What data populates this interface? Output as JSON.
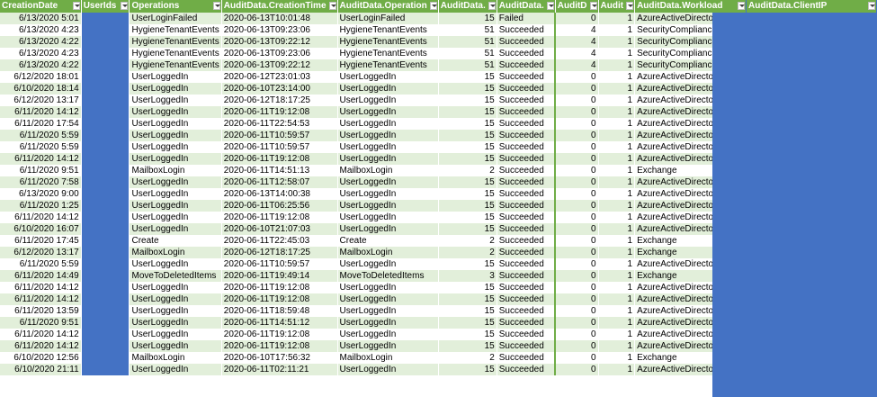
{
  "headers": [
    "CreationDate",
    "UserIds",
    "Operations",
    "AuditData.CreationTime",
    "AuditData.Operation",
    "AuditData.",
    "AuditData.",
    "AuditD",
    "Audit",
    "AuditData.Workload",
    "AuditData.ClientIP"
  ],
  "rows": [
    [
      "6/13/2020 5:01",
      "",
      "UserLoginFailed",
      "2020-06-13T10:01:48",
      "UserLoginFailed",
      "15",
      "Failed",
      "0",
      "1",
      "AzureActiveDirectory",
      ""
    ],
    [
      "6/13/2020 4:23",
      "",
      "HygieneTenantEvents",
      "2020-06-13T09:23:06",
      "HygieneTenantEvents",
      "51",
      "Succeeded",
      "4",
      "1",
      "SecurityComplianceCenter",
      ""
    ],
    [
      "6/13/2020 4:22",
      "",
      "HygieneTenantEvents",
      "2020-06-13T09:22:12",
      "HygieneTenantEvents",
      "51",
      "Succeeded",
      "4",
      "1",
      "SecurityComplianceCenter",
      ""
    ],
    [
      "6/13/2020 4:23",
      "",
      "HygieneTenantEvents",
      "2020-06-13T09:23:06",
      "HygieneTenantEvents",
      "51",
      "Succeeded",
      "4",
      "1",
      "SecurityComplianceCenter",
      ""
    ],
    [
      "6/13/2020 4:22",
      "",
      "HygieneTenantEvents",
      "2020-06-13T09:22:12",
      "HygieneTenantEvents",
      "51",
      "Succeeded",
      "4",
      "1",
      "SecurityComplianceCenter",
      ""
    ],
    [
      "6/12/2020 18:01",
      "",
      "UserLoggedIn",
      "2020-06-12T23:01:03",
      "UserLoggedIn",
      "15",
      "Succeeded",
      "0",
      "1",
      "AzureActiveDirectory",
      ""
    ],
    [
      "6/10/2020 18:14",
      "",
      "UserLoggedIn",
      "2020-06-10T23:14:00",
      "UserLoggedIn",
      "15",
      "Succeeded",
      "0",
      "1",
      "AzureActiveDirectory",
      ""
    ],
    [
      "6/12/2020 13:17",
      "",
      "UserLoggedIn",
      "2020-06-12T18:17:25",
      "UserLoggedIn",
      "15",
      "Succeeded",
      "0",
      "1",
      "AzureActiveDirectory",
      ""
    ],
    [
      "6/11/2020 14:12",
      "",
      "UserLoggedIn",
      "2020-06-11T19:12:08",
      "UserLoggedIn",
      "15",
      "Succeeded",
      "0",
      "1",
      "AzureActiveDirectory",
      ""
    ],
    [
      "6/11/2020 17:54",
      "",
      "UserLoggedIn",
      "2020-06-11T22:54:53",
      "UserLoggedIn",
      "15",
      "Succeeded",
      "0",
      "1",
      "AzureActiveDirectory",
      ""
    ],
    [
      "6/11/2020 5:59",
      "",
      "UserLoggedIn",
      "2020-06-11T10:59:57",
      "UserLoggedIn",
      "15",
      "Succeeded",
      "0",
      "1",
      "AzureActiveDirectory",
      ""
    ],
    [
      "6/11/2020 5:59",
      "",
      "UserLoggedIn",
      "2020-06-11T10:59:57",
      "UserLoggedIn",
      "15",
      "Succeeded",
      "0",
      "1",
      "AzureActiveDirectory",
      ""
    ],
    [
      "6/11/2020 14:12",
      "",
      "UserLoggedIn",
      "2020-06-11T19:12:08",
      "UserLoggedIn",
      "15",
      "Succeeded",
      "0",
      "1",
      "AzureActiveDirectory",
      ""
    ],
    [
      "6/11/2020 9:51",
      "",
      "MailboxLogin",
      "2020-06-11T14:51:13",
      "MailboxLogin",
      "2",
      "Succeeded",
      "0",
      "1",
      "Exchange",
      ""
    ],
    [
      "6/11/2020 7:58",
      "",
      "UserLoggedIn",
      "2020-06-11T12:58:07",
      "UserLoggedIn",
      "15",
      "Succeeded",
      "0",
      "1",
      "AzureActiveDirectory",
      ""
    ],
    [
      "6/13/2020 9:00",
      "",
      "UserLoggedIn",
      "2020-06-13T14:00:38",
      "UserLoggedIn",
      "15",
      "Succeeded",
      "0",
      "1",
      "AzureActiveDirectory",
      ""
    ],
    [
      "6/11/2020 1:25",
      "",
      "UserLoggedIn",
      "2020-06-11T06:25:56",
      "UserLoggedIn",
      "15",
      "Succeeded",
      "0",
      "1",
      "AzureActiveDirectory",
      ""
    ],
    [
      "6/11/2020 14:12",
      "",
      "UserLoggedIn",
      "2020-06-11T19:12:08",
      "UserLoggedIn",
      "15",
      "Succeeded",
      "0",
      "1",
      "AzureActiveDirectory",
      ""
    ],
    [
      "6/10/2020 16:07",
      "",
      "UserLoggedIn",
      "2020-06-10T21:07:03",
      "UserLoggedIn",
      "15",
      "Succeeded",
      "0",
      "1",
      "AzureActiveDirectory",
      ""
    ],
    [
      "6/11/2020 17:45",
      "",
      "Create",
      "2020-06-11T22:45:03",
      "Create",
      "2",
      "Succeeded",
      "0",
      "1",
      "Exchange",
      ""
    ],
    [
      "6/12/2020 13:17",
      "",
      "MailboxLogin",
      "2020-06-12T18:17:25",
      "MailboxLogin",
      "2",
      "Succeeded",
      "0",
      "1",
      "Exchange",
      ""
    ],
    [
      "6/11/2020 5:59",
      "",
      "UserLoggedIn",
      "2020-06-11T10:59:57",
      "UserLoggedIn",
      "15",
      "Succeeded",
      "0",
      "1",
      "AzureActiveDirectory",
      ""
    ],
    [
      "6/11/2020 14:49",
      "",
      "MoveToDeletedItems",
      "2020-06-11T19:49:14",
      "MoveToDeletedItems",
      "3",
      "Succeeded",
      "0",
      "1",
      "Exchange",
      ""
    ],
    [
      "6/11/2020 14:12",
      "",
      "UserLoggedIn",
      "2020-06-11T19:12:08",
      "UserLoggedIn",
      "15",
      "Succeeded",
      "0",
      "1",
      "AzureActiveDirectory",
      ""
    ],
    [
      "6/11/2020 14:12",
      "",
      "UserLoggedIn",
      "2020-06-11T19:12:08",
      "UserLoggedIn",
      "15",
      "Succeeded",
      "0",
      "1",
      "AzureActiveDirectory",
      ""
    ],
    [
      "6/11/2020 13:59",
      "",
      "UserLoggedIn",
      "2020-06-11T18:59:48",
      "UserLoggedIn",
      "15",
      "Succeeded",
      "0",
      "1",
      "AzureActiveDirectory",
      ""
    ],
    [
      "6/11/2020 9:51",
      "",
      "UserLoggedIn",
      "2020-06-11T14:51:12",
      "UserLoggedIn",
      "15",
      "Succeeded",
      "0",
      "1",
      "AzureActiveDirectory",
      ""
    ],
    [
      "6/11/2020 14:12",
      "",
      "UserLoggedIn",
      "2020-06-11T19:12:08",
      "UserLoggedIn",
      "15",
      "Succeeded",
      "0",
      "1",
      "AzureActiveDirectory",
      ""
    ],
    [
      "6/11/2020 14:12",
      "",
      "UserLoggedIn",
      "2020-06-11T19:12:08",
      "UserLoggedIn",
      "15",
      "Succeeded",
      "0",
      "1",
      "AzureActiveDirectory",
      ""
    ],
    [
      "6/10/2020 12:56",
      "",
      "MailboxLogin",
      "2020-06-10T17:56:32",
      "MailboxLogin",
      "2",
      "Succeeded",
      "0",
      "1",
      "Exchange",
      ""
    ],
    [
      "6/10/2020 21:11",
      "",
      "UserLoggedIn",
      "2020-06-11T02:11:21",
      "UserLoggedIn",
      "15",
      "Succeeded",
      "0",
      "1",
      "AzureActiveDirectory",
      ""
    ]
  ],
  "colors": {
    "header": "#70ad47",
    "band": "#e2efda",
    "redacted": "#4472c4"
  }
}
